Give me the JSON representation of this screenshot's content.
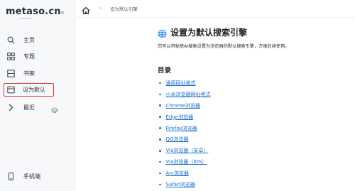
{
  "sidebar": {
    "logo": "metaso.cn",
    "logo_sub": "by Metaso AI",
    "collapse_glyph": "«",
    "items": [
      {
        "label": "主页",
        "icon": "search-icon"
      },
      {
        "label": "专题",
        "icon": "grid-icon"
      },
      {
        "label": "书架",
        "icon": "bookshelf-icon"
      },
      {
        "label": "设为默认",
        "icon": "browser-window-icon",
        "selected": true
      },
      {
        "label": "最近",
        "icon": "chevron-right-icon",
        "extra_icon": "layers-icon"
      }
    ],
    "bottom_item": {
      "label": "手机端",
      "icon": "phone-icon"
    }
  },
  "breadcrumb": {
    "home_icon": "home-icon",
    "separator": ">",
    "current": "设为默认引擎"
  },
  "page": {
    "title_icon": "globe-icon",
    "title": "设置为默认搜索引擎",
    "description": "您可以将秘塔AI搜索设置为浏览器的默认搜索引擎，方便后续使用。",
    "toc_title": "目录",
    "toc_items": [
      "通用网址格式",
      "小米浏览器网址格式",
      "Chrome浏览器",
      "Edge浏览器",
      "Firefox浏览器",
      "QQ浏览器",
      "Via浏览器（安卓）",
      "Via浏览器（iOS）",
      "Arc浏览器",
      "Safari浏览器"
    ]
  },
  "colors": {
    "accent": "#1a6fd6",
    "selected_outline": "#e0353d",
    "sidebar_bg": "#f7f8fa"
  }
}
